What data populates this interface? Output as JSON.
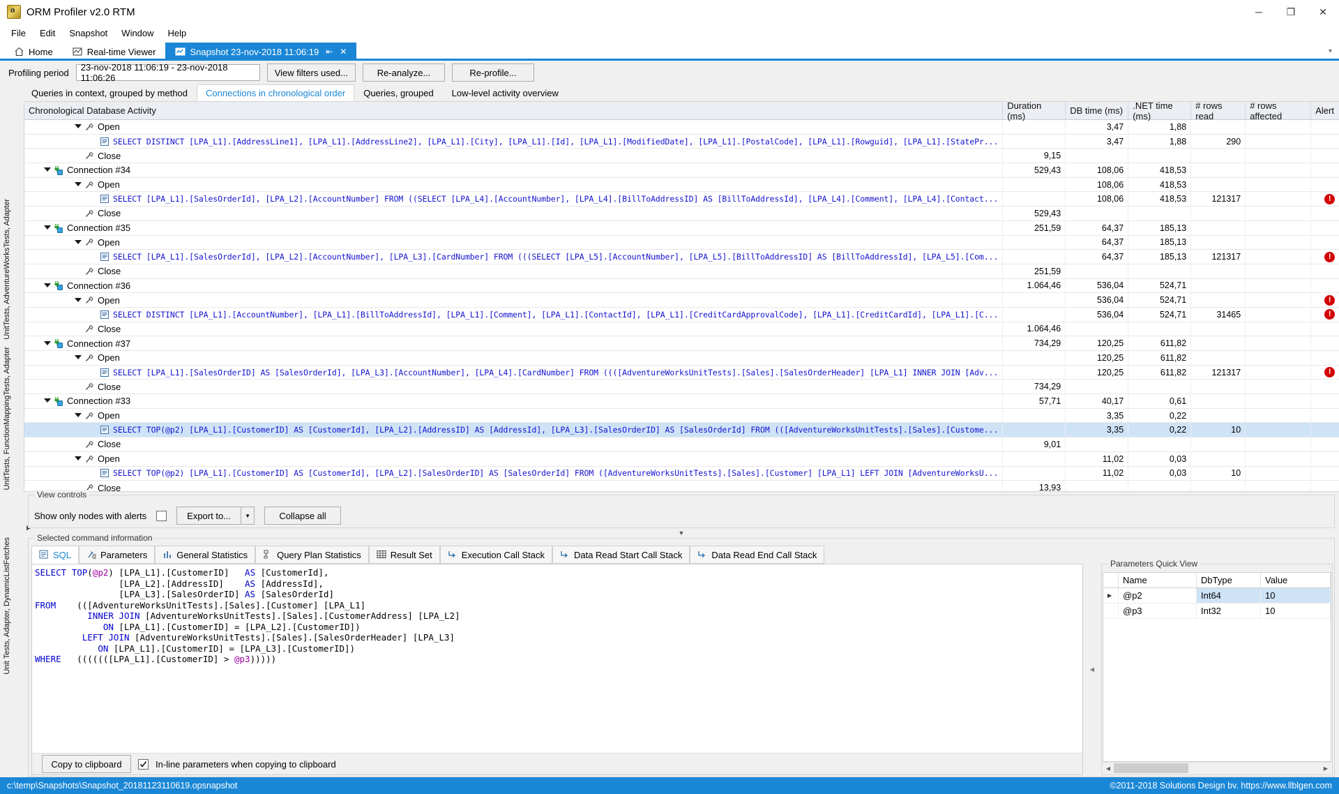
{
  "window": {
    "title": "ORM Profiler v2.0 RTM",
    "app_icon": "orm-profiler-icon",
    "minimize": "─",
    "maximize": "❐",
    "close": "✕"
  },
  "menu": {
    "items": [
      "File",
      "Edit",
      "Snapshot",
      "Window",
      "Help"
    ]
  },
  "doc_tabs": {
    "items": [
      {
        "label": "Home",
        "icon": "home-icon",
        "active": false
      },
      {
        "label": "Real-time Viewer",
        "icon": "realtime-viewer-icon",
        "active": false
      },
      {
        "label": "Snapshot 23-nov-2018 11:06:19",
        "icon": "snapshot-icon",
        "active": true
      }
    ],
    "pin_glyph": "⇤",
    "close_glyph": "✕",
    "overflow_glyph": "▾"
  },
  "profiling": {
    "label": "Profiling period",
    "period": "23-nov-2018 11:06:19  -  23-nov-2018 11:06:26",
    "buttons": [
      "View filters used...",
      "Re-analyze...",
      "Re-profile..."
    ]
  },
  "view_tabs": {
    "items": [
      {
        "label": "Queries in context, grouped by method",
        "active": false
      },
      {
        "label": "Connections in chronological order",
        "active": true
      },
      {
        "label": "Queries, grouped",
        "active": false
      },
      {
        "label": "Low-level activity overview",
        "active": false
      }
    ]
  },
  "left_rail": {
    "items": [
      "UnitTests, AdventureWorksTests, Adapter",
      "UnitTests, FunctionMappingTests, Adapter",
      "Unit Tests, Adapter, DynamicListFetches"
    ]
  },
  "grid": {
    "columns": [
      "Chronological Database Activity",
      "Duration (ms)",
      "DB time (ms)",
      ".NET time (ms)",
      "# rows read",
      "# rows affected",
      "Alert"
    ],
    "rows": [
      {
        "indent": 3,
        "type": "open",
        "expander": true,
        "icon": "plug-open-icon",
        "label": "Open",
        "duration": "",
        "dbtime": "3,47",
        "nettime": "1,88",
        "rowsread": "",
        "rowsaffected": "",
        "alert": false,
        "selected": false
      },
      {
        "indent": 4,
        "type": "query",
        "expander": false,
        "icon": "sql-command-icon",
        "label": "SELECT DISTINCT [LPA_L1].[AddressLine1], [LPA_L1].[AddressLine2], [LPA_L1].[City], [LPA_L1].[Id], [LPA_L1].[ModifiedDate], [LPA_L1].[PostalCode], [LPA_L1].[Rowguid], [LPA_L1].[StatePr...",
        "duration": "",
        "dbtime": "3,47",
        "nettime": "1,88",
        "rowsread": "290",
        "rowsaffected": "",
        "alert": false,
        "selected": false
      },
      {
        "indent": 3,
        "type": "close",
        "expander": false,
        "icon": "plug-close-icon",
        "label": "Close",
        "duration": "9,15",
        "dbtime": "",
        "nettime": "",
        "rowsread": "",
        "rowsaffected": "",
        "alert": false,
        "selected": false
      },
      {
        "indent": 1,
        "type": "connection",
        "expander": true,
        "icon": "connection-icon",
        "label": "Connection #34",
        "duration": "529,43",
        "dbtime": "108,06",
        "nettime": "418,53",
        "rowsread": "",
        "rowsaffected": "",
        "alert": false,
        "selected": false
      },
      {
        "indent": 3,
        "type": "open",
        "expander": true,
        "icon": "plug-open-icon",
        "label": "Open",
        "duration": "",
        "dbtime": "108,06",
        "nettime": "418,53",
        "rowsread": "",
        "rowsaffected": "",
        "alert": false,
        "selected": false
      },
      {
        "indent": 4,
        "type": "query",
        "expander": false,
        "icon": "sql-command-icon",
        "label": "SELECT [LPA_L1].[SalesOrderId], [LPA_L2].[AccountNumber] FROM ((SELECT [LPA_L4].[AccountNumber], [LPA_L4].[BillToAddressID] AS [BillToAddressId], [LPA_L4].[Comment], [LPA_L4].[Contact...",
        "duration": "",
        "dbtime": "108,06",
        "nettime": "418,53",
        "rowsread": "121317",
        "rowsaffected": "",
        "alert": true,
        "selected": false
      },
      {
        "indent": 3,
        "type": "close",
        "expander": false,
        "icon": "plug-close-icon",
        "label": "Close",
        "duration": "529,43",
        "dbtime": "",
        "nettime": "",
        "rowsread": "",
        "rowsaffected": "",
        "alert": false,
        "selected": false
      },
      {
        "indent": 1,
        "type": "connection",
        "expander": true,
        "icon": "connection-icon",
        "label": "Connection #35",
        "duration": "251,59",
        "dbtime": "64,37",
        "nettime": "185,13",
        "rowsread": "",
        "rowsaffected": "",
        "alert": false,
        "selected": false
      },
      {
        "indent": 3,
        "type": "open",
        "expander": true,
        "icon": "plug-open-icon",
        "label": "Open",
        "duration": "",
        "dbtime": "64,37",
        "nettime": "185,13",
        "rowsread": "",
        "rowsaffected": "",
        "alert": false,
        "selected": false
      },
      {
        "indent": 4,
        "type": "query",
        "expander": false,
        "icon": "sql-command-icon",
        "label": "SELECT [LPA_L1].[SalesOrderId], [LPA_L2].[AccountNumber], [LPA_L3].[CardNumber] FROM (((SELECT [LPA_L5].[AccountNumber], [LPA_L5].[BillToAddressID] AS [BillToAddressId], [LPA_L5].[Com...",
        "duration": "",
        "dbtime": "64,37",
        "nettime": "185,13",
        "rowsread": "121317",
        "rowsaffected": "",
        "alert": true,
        "selected": false
      },
      {
        "indent": 3,
        "type": "close",
        "expander": false,
        "icon": "plug-close-icon",
        "label": "Close",
        "duration": "251,59",
        "dbtime": "",
        "nettime": "",
        "rowsread": "",
        "rowsaffected": "",
        "alert": false,
        "selected": false
      },
      {
        "indent": 1,
        "type": "connection",
        "expander": true,
        "icon": "connection-icon",
        "label": "Connection #36",
        "duration": "1.064,46",
        "dbtime": "536,04",
        "nettime": "524,71",
        "rowsread": "",
        "rowsaffected": "",
        "alert": false,
        "selected": false
      },
      {
        "indent": 3,
        "type": "open",
        "expander": true,
        "icon": "plug-open-icon",
        "label": "Open",
        "duration": "",
        "dbtime": "536,04",
        "nettime": "524,71",
        "rowsread": "",
        "rowsaffected": "",
        "alert": true,
        "selected": false
      },
      {
        "indent": 4,
        "type": "query",
        "expander": false,
        "icon": "sql-command-icon",
        "label": "SELECT DISTINCT [LPA_L1].[AccountNumber], [LPA_L1].[BillToAddressId], [LPA_L1].[Comment], [LPA_L1].[ContactId], [LPA_L1].[CreditCardApprovalCode], [LPA_L1].[CreditCardId], [LPA_L1].[C...",
        "duration": "",
        "dbtime": "536,04",
        "nettime": "524,71",
        "rowsread": "31465",
        "rowsaffected": "",
        "alert": true,
        "selected": false
      },
      {
        "indent": 3,
        "type": "close",
        "expander": false,
        "icon": "plug-close-icon",
        "label": "Close",
        "duration": "1.064,46",
        "dbtime": "",
        "nettime": "",
        "rowsread": "",
        "rowsaffected": "",
        "alert": false,
        "selected": false
      },
      {
        "indent": 1,
        "type": "connection",
        "expander": true,
        "icon": "connection-icon",
        "label": "Connection #37",
        "duration": "734,29",
        "dbtime": "120,25",
        "nettime": "611,82",
        "rowsread": "",
        "rowsaffected": "",
        "alert": false,
        "selected": false
      },
      {
        "indent": 3,
        "type": "open",
        "expander": true,
        "icon": "plug-open-icon",
        "label": "Open",
        "duration": "",
        "dbtime": "120,25",
        "nettime": "611,82",
        "rowsread": "",
        "rowsaffected": "",
        "alert": false,
        "selected": false
      },
      {
        "indent": 4,
        "type": "query",
        "expander": false,
        "icon": "sql-command-icon",
        "label": "SELECT [LPA_L1].[SalesOrderID] AS [SalesOrderId], [LPA_L3].[AccountNumber], [LPA_L4].[CardNumber] FROM ((([AdventureWorksUnitTests].[Sales].[SalesOrderHeader] [LPA_L1] INNER JOIN [Adv...",
        "duration": "",
        "dbtime": "120,25",
        "nettime": "611,82",
        "rowsread": "121317",
        "rowsaffected": "",
        "alert": true,
        "selected": false
      },
      {
        "indent": 3,
        "type": "close",
        "expander": false,
        "icon": "plug-close-icon",
        "label": "Close",
        "duration": "734,29",
        "dbtime": "",
        "nettime": "",
        "rowsread": "",
        "rowsaffected": "",
        "alert": false,
        "selected": false
      },
      {
        "indent": 1,
        "type": "connection",
        "expander": true,
        "icon": "connection-icon",
        "label": "Connection #33",
        "duration": "57,71",
        "dbtime": "40,17",
        "nettime": "0,61",
        "rowsread": "",
        "rowsaffected": "",
        "alert": false,
        "selected": false
      },
      {
        "indent": 3,
        "type": "open",
        "expander": true,
        "icon": "plug-open-icon",
        "label": "Open",
        "duration": "",
        "dbtime": "3,35",
        "nettime": "0,22",
        "rowsread": "",
        "rowsaffected": "",
        "alert": false,
        "selected": false
      },
      {
        "indent": 4,
        "type": "query",
        "expander": false,
        "icon": "sql-command-icon",
        "label": "SELECT TOP(@p2) [LPA_L1].[CustomerID] AS [CustomerId], [LPA_L2].[AddressID] AS [AddressId], [LPA_L3].[SalesOrderID] AS [SalesOrderId] FROM (([AdventureWorksUnitTests].[Sales].[Custome...",
        "duration": "",
        "dbtime": "3,35",
        "nettime": "0,22",
        "rowsread": "10",
        "rowsaffected": "",
        "alert": false,
        "selected": true
      },
      {
        "indent": 3,
        "type": "close",
        "expander": false,
        "icon": "plug-close-icon",
        "label": "Close",
        "duration": "9,01",
        "dbtime": "",
        "nettime": "",
        "rowsread": "",
        "rowsaffected": "",
        "alert": false,
        "selected": false
      },
      {
        "indent": 3,
        "type": "open",
        "expander": true,
        "icon": "plug-open-icon",
        "label": "Open",
        "duration": "",
        "dbtime": "11,02",
        "nettime": "0,03",
        "rowsread": "",
        "rowsaffected": "",
        "alert": false,
        "selected": false
      },
      {
        "indent": 4,
        "type": "query",
        "expander": false,
        "icon": "sql-command-icon",
        "label": "SELECT TOP(@p2) [LPA_L1].[CustomerID] AS [CustomerId], [LPA_L2].[SalesOrderID] AS [SalesOrderId] FROM ([AdventureWorksUnitTests].[Sales].[Customer] [LPA_L1] LEFT JOIN [AdventureWorksU...",
        "duration": "",
        "dbtime": "11,02",
        "nettime": "0,03",
        "rowsread": "10",
        "rowsaffected": "",
        "alert": false,
        "selected": false
      },
      {
        "indent": 3,
        "type": "close",
        "expander": false,
        "icon": "plug-close-icon",
        "label": "Close",
        "duration": "13,93",
        "dbtime": "",
        "nettime": "",
        "rowsread": "",
        "rowsaffected": "",
        "alert": false,
        "selected": false
      }
    ]
  },
  "view_controls": {
    "legend": "View controls",
    "show_only_alerts_label": "Show only nodes with alerts",
    "show_only_alerts_checked": false,
    "export_label": "Export to...",
    "collapse_label": "Collapse all"
  },
  "command_info": {
    "legend": "Selected command information",
    "tabs": [
      {
        "label": "SQL",
        "icon": "sql-tab-icon",
        "active": true
      },
      {
        "label": "Parameters",
        "icon": "parameters-icon",
        "active": false
      },
      {
        "label": "General Statistics",
        "icon": "bar-chart-icon",
        "active": false
      },
      {
        "label": "Query Plan Statistics",
        "icon": "query-plan-icon",
        "active": false
      },
      {
        "label": "Result Set",
        "icon": "table-grid-icon",
        "active": false
      },
      {
        "label": "Execution Call Stack",
        "icon": "call-stack-icon",
        "active": false
      },
      {
        "label": "Data Read Start Call Stack",
        "icon": "call-stack-icon",
        "active": false
      },
      {
        "label": "Data Read End Call Stack",
        "icon": "call-stack-icon",
        "active": false
      }
    ],
    "sql_lines": [
      "SELECT TOP(@p2) [LPA_L1].[CustomerID]   AS [CustomerId],",
      "                [LPA_L2].[AddressID]    AS [AddressId],",
      "                [LPA_L3].[SalesOrderID] AS [SalesOrderId]",
      "FROM    (([AdventureWorksUnitTests].[Sales].[Customer] [LPA_L1]",
      "          INNER JOIN [AdventureWorksUnitTests].[Sales].[CustomerAddress] [LPA_L2]",
      "             ON [LPA_L1].[CustomerID] = [LPA_L2].[CustomerID])",
      "         LEFT JOIN [AdventureWorksUnitTests].[Sales].[SalesOrderHeader] [LPA_L3]",
      "            ON [LPA_L1].[CustomerID] = [LPA_L3].[CustomerID])",
      "WHERE   (((((([LPA_L1].[CustomerID] > @p3)))))"
    ],
    "copy_label": "Copy to clipboard",
    "inline_params_label": "In-line parameters when copying to clipboard",
    "inline_params_checked": true
  },
  "parameters_quick_view": {
    "legend": "Parameters Quick View",
    "columns": [
      "",
      "Name",
      "DbType",
      "Value"
    ],
    "rows": [
      {
        "marker": "▶",
        "name": "@p2",
        "dbtype": "Int64",
        "value": "10",
        "selected": true
      },
      {
        "marker": "",
        "name": "@p3",
        "dbtype": "Int32",
        "value": "10",
        "selected": false
      }
    ]
  },
  "status_bar": {
    "path": "c:\\temp\\Snapshots\\Snapshot_20181123110619.opsnapshot",
    "copyright": "©2011-2018 Solutions Design bv. https://www.llblgen.com"
  },
  "colors": {
    "accent": "#1a87d6",
    "sql_text": "#1414cf",
    "alert": "#d40000",
    "selection": "#cfe3f7"
  }
}
